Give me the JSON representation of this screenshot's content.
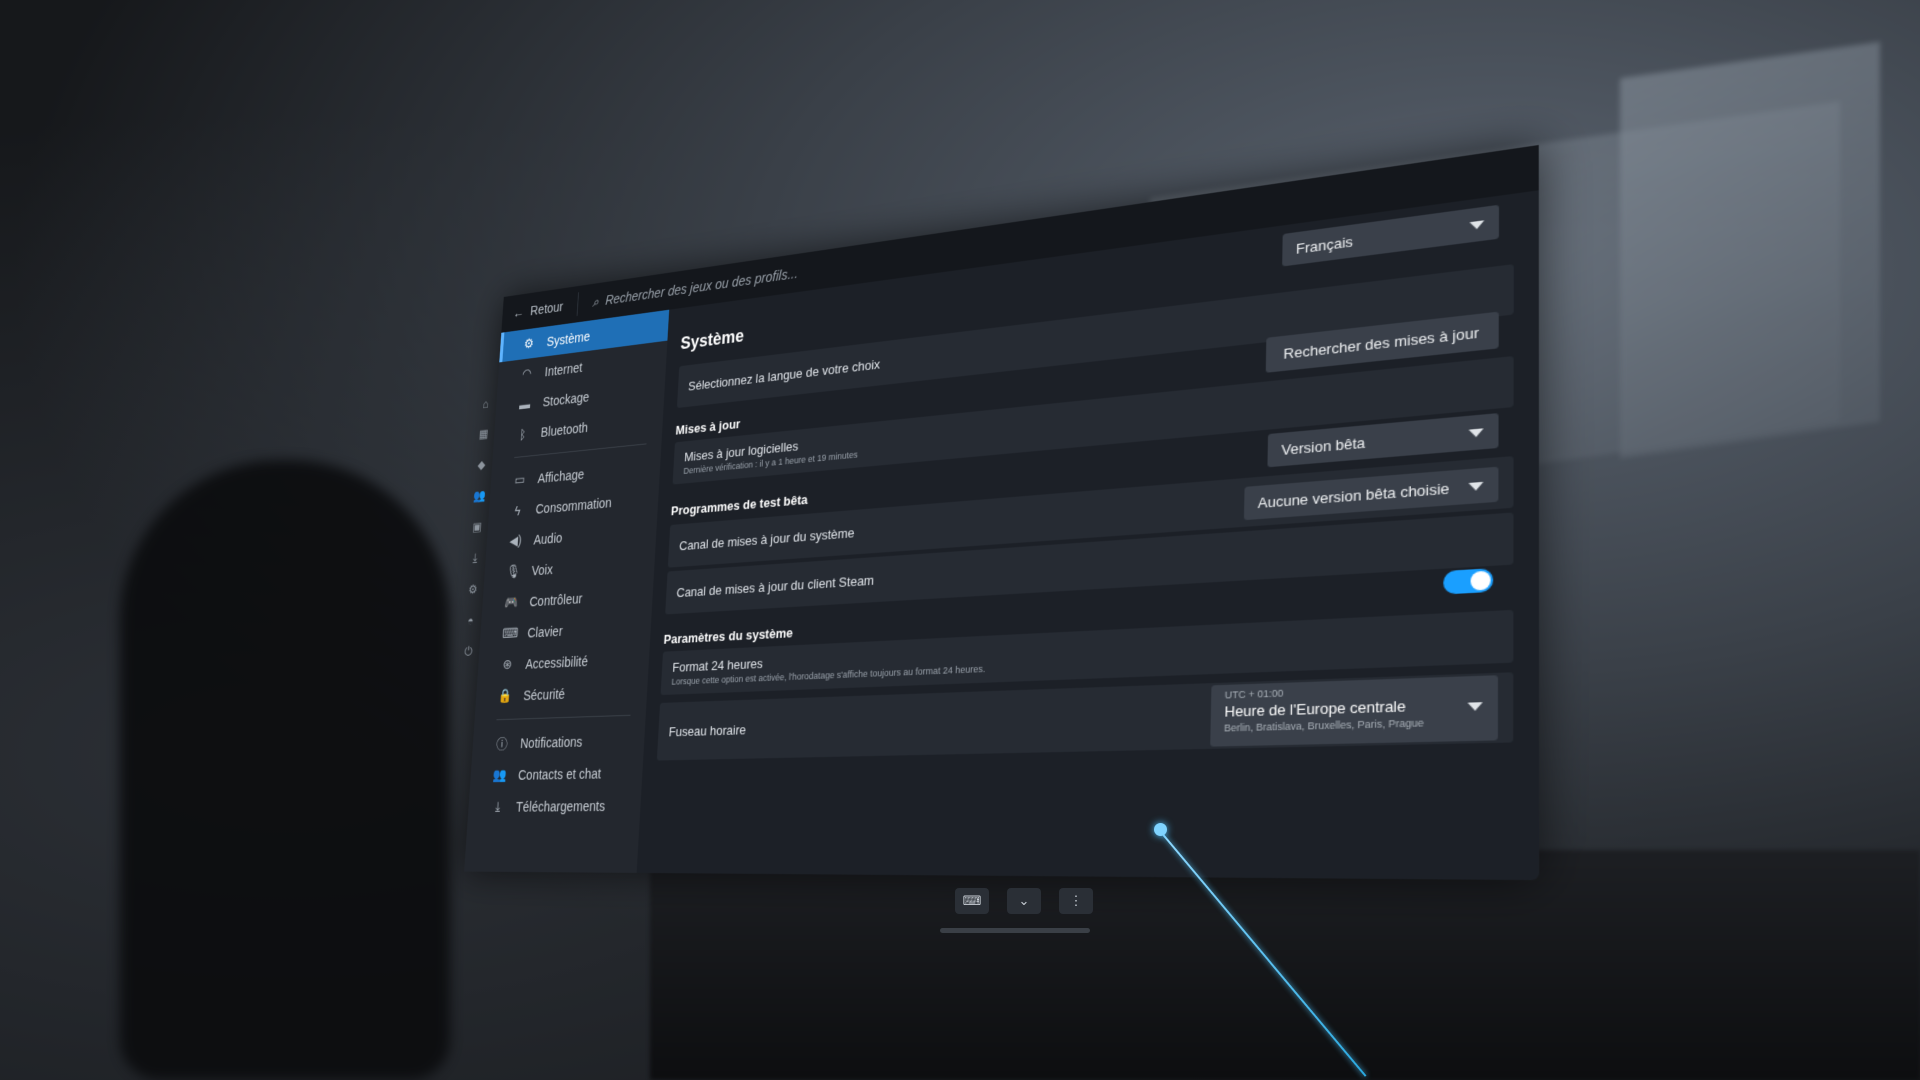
{
  "topbar": {
    "back_label": "Retour",
    "search_placeholder": "Rechercher des jeux ou des profils..."
  },
  "sidebar": {
    "items": [
      {
        "label": "Système",
        "icon": "gear-icon",
        "active": true
      },
      {
        "label": "Internet",
        "icon": "wifi-icon"
      },
      {
        "label": "Stockage",
        "icon": "storage-icon"
      },
      {
        "label": "Bluetooth",
        "icon": "bluetooth-icon"
      },
      {
        "label": "Affichage",
        "icon": "monitor-icon"
      },
      {
        "label": "Consommation",
        "icon": "lightning-icon"
      },
      {
        "label": "Audio",
        "icon": "speaker-icon"
      },
      {
        "label": "Voix",
        "icon": "microphone-icon"
      },
      {
        "label": "Contrôleur",
        "icon": "gamepad-icon"
      },
      {
        "label": "Clavier",
        "icon": "keyboard-icon"
      },
      {
        "label": "Accessibilité",
        "icon": "accessibility-icon"
      },
      {
        "label": "Sécurité",
        "icon": "lock-icon"
      },
      {
        "label": "Notifications",
        "icon": "info-icon"
      },
      {
        "label": "Contacts et chat",
        "icon": "friends-icon"
      },
      {
        "label": "Téléchargements",
        "icon": "download-icon"
      }
    ]
  },
  "main": {
    "title": "Système",
    "language": {
      "label": "Sélectionnez la langue de votre choix",
      "value": "Français"
    },
    "updates": {
      "section": "Mises à jour",
      "row_label": "Mises à jour logicielles",
      "row_sub": "Dernière vérification : il y a 1 heure et 19 minutes",
      "button": "Rechercher des mises à jour"
    },
    "beta": {
      "section": "Programmes de test bêta",
      "section_value": "Version bêta",
      "system_channel_label": "Canal de mises à jour du système",
      "system_channel_value": "Aucune version bêta choisie",
      "client_channel_label": "Canal de mises à jour du client Steam"
    },
    "system_params": {
      "section": "Paramètres du système",
      "format24_label": "Format 24 heures",
      "format24_sub": "Lorsque cette option est activée, l'horodatage s'affiche toujours au format 24 heures.",
      "format24_on": true,
      "timezone_label": "Fuseau horaire",
      "timezone_offset": "UTC + 01:00",
      "timezone_name": "Heure de l'Europe centrale",
      "timezone_cities": "Berlin, Bratislava, Bruxelles, Paris, Prague"
    }
  },
  "colors": {
    "accent": "#1a9fff",
    "active_item": "#1f6fb6",
    "panel_bg": "#1c2027"
  }
}
